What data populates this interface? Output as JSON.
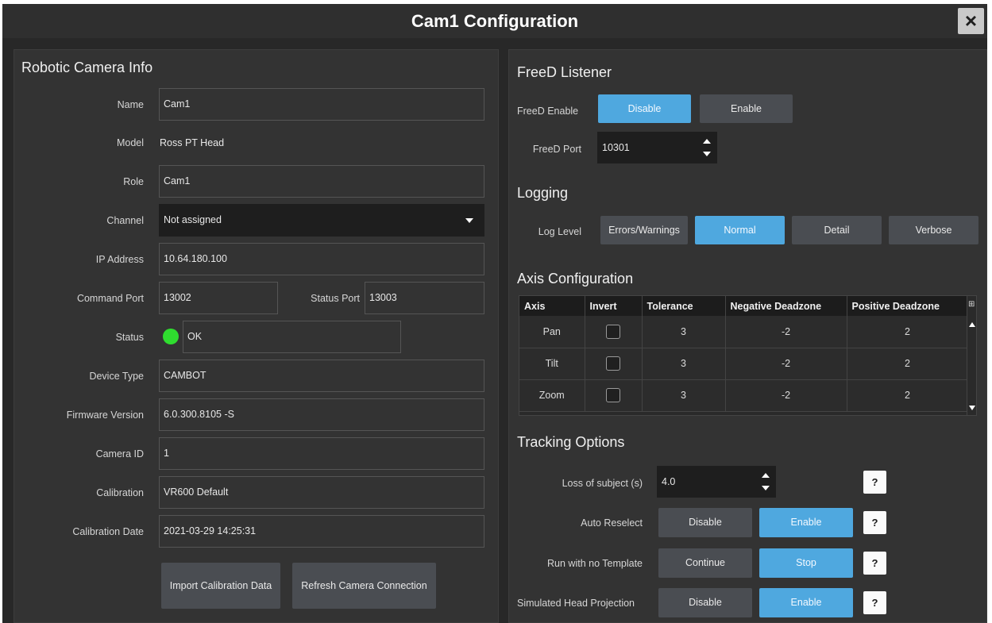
{
  "window": {
    "title": "Cam1 Configuration",
    "close_icon": "×"
  },
  "left_panel": {
    "heading": "Robotic Camera Info",
    "fields": {
      "name": {
        "label": "Name",
        "value": "Cam1"
      },
      "model": {
        "label": "Model",
        "value": "Ross PT Head"
      },
      "role": {
        "label": "Role",
        "value": "Cam1"
      },
      "channel": {
        "label": "Channel",
        "value": "Not assigned"
      },
      "ip": {
        "label": "IP Address",
        "value": "10.64.180.100"
      },
      "command_port": {
        "label": "Command Port",
        "value": "13002"
      },
      "status_port": {
        "label": "Status Port",
        "value": "13003"
      },
      "status": {
        "label": "Status",
        "value": "OK",
        "color": "#2fdd2f"
      },
      "device_type": {
        "label": "Device Type",
        "value": "CAMBOT"
      },
      "firmware": {
        "label": "Firmware Version",
        "value": "6.0.300.8105 -S"
      },
      "camera_id": {
        "label": "Camera ID",
        "value": "1"
      },
      "calibration": {
        "label": "Calibration",
        "value": "VR600 Default"
      },
      "calibration_date": {
        "label": "Calibration Date",
        "value": "2021-03-29 14:25:31"
      }
    },
    "buttons": {
      "import": "Import Calibration Data",
      "refresh": "Refresh Camera Connection"
    }
  },
  "right_panel": {
    "freed": {
      "heading": "FreeD Listener",
      "enable_label": "FreeD Enable",
      "disable_btn": "Disable",
      "enable_btn": "Enable",
      "selected": "Disable",
      "port_label": "FreeD Port",
      "port_value": "10301"
    },
    "logging": {
      "heading": "Logging",
      "level_label": "Log Level",
      "options": [
        "Errors/Warnings",
        "Normal",
        "Detail",
        "Verbose"
      ],
      "selected": "Normal"
    },
    "axis": {
      "heading": "Axis Configuration",
      "columns": [
        "Axis",
        "Invert",
        "Tolerance",
        "Negative Deadzone",
        "Positive Deadzone"
      ],
      "rows": [
        {
          "axis": "Pan",
          "invert": false,
          "tolerance": "3",
          "neg": "-2",
          "pos": "2"
        },
        {
          "axis": "Tilt",
          "invert": false,
          "tolerance": "3",
          "neg": "-2",
          "pos": "2"
        },
        {
          "axis": "Zoom",
          "invert": false,
          "tolerance": "3",
          "neg": "-2",
          "pos": "2"
        }
      ]
    },
    "tracking": {
      "heading": "Tracking Options",
      "loss_label": "Loss of subject (s)",
      "loss_value": "4.0",
      "auto_reselect": {
        "label": "Auto Reselect",
        "options": [
          "Disable",
          "Enable"
        ],
        "selected": "Enable"
      },
      "no_template": {
        "label": "Run with no Template",
        "options": [
          "Continue",
          "Stop"
        ],
        "selected": "Stop"
      },
      "sim_head": {
        "label": "Simulated Head Projection",
        "options": [
          "Disable",
          "Enable"
        ],
        "selected": "Enable"
      },
      "help": "?"
    }
  },
  "colors": {
    "accent": "#4fa8df",
    "button": "#4a4d52",
    "status_ok": "#2fdd2f"
  }
}
